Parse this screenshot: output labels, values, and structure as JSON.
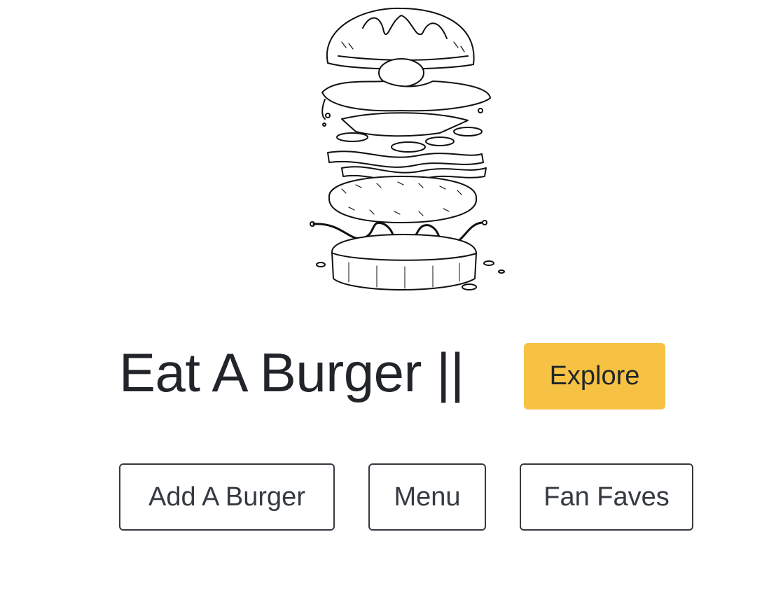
{
  "hero": {
    "illustration": "exploded-burger-line-drawing"
  },
  "title": {
    "text": "Eat A Burger ||"
  },
  "buttons": {
    "explore": "Explore",
    "add_burger": "Add A Burger",
    "menu": "Menu",
    "fan_faves": "Fan Faves"
  },
  "colors": {
    "accent": "#f7c244",
    "text": "#212529",
    "outline": "#343a40"
  }
}
